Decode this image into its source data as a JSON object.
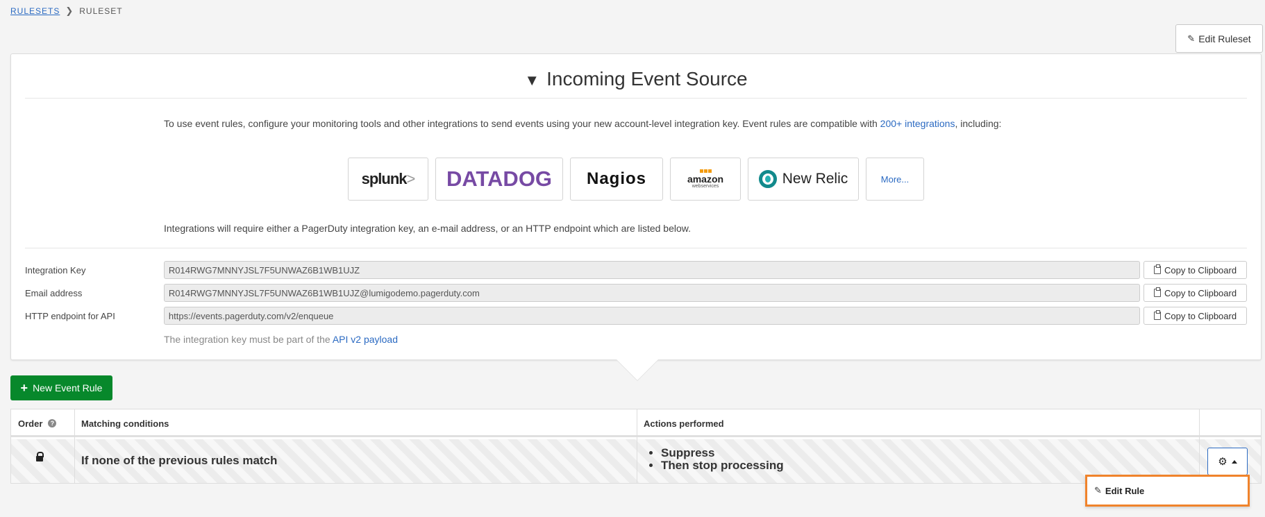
{
  "breadcrumb": {
    "link": "RULESETS",
    "separator": "❯",
    "current": "RULESET"
  },
  "header": {
    "edit_ruleset_label": "Edit Ruleset"
  },
  "panel": {
    "title": "Incoming Event Source",
    "toggle_glyph": "▼",
    "intro_prefix": "To use event rules, configure your monitoring tools and other integrations to send events using your new account-level integration key. Event rules are compatible with ",
    "intro_link": "200+ integrations",
    "intro_suffix": ", including:",
    "logos": {
      "splunk": "splunk",
      "splunk_mark": ">",
      "datadog": "DATADOG",
      "nagios": "Nagios",
      "amazon": "amazon",
      "amazon_sub": "webservices",
      "newrelic": "New Relic",
      "more": "More..."
    },
    "requirement_text": "Integrations will require either a PagerDuty integration key, an e-mail address, or an HTTP endpoint which are listed below.",
    "fields": [
      {
        "label": "Integration Key",
        "value": "R014RWG7MNNYJSL7F5UNWAZ6B1WB1UJZ",
        "button": "Copy to Clipboard"
      },
      {
        "label": "Email address",
        "value": "R014RWG7MNNYJSL7F5UNWAZ6B1WB1UJZ@lumigodemo.pagerduty.com",
        "button": "Copy to Clipboard"
      },
      {
        "label": "HTTP endpoint for API",
        "value": "https://events.pagerduty.com/v2/enqueue",
        "button": "Copy to Clipboard"
      }
    ],
    "help_prefix": "The integration key must be part of the ",
    "help_link": "API v2 payload"
  },
  "new_rule_button": {
    "icon": "+",
    "label": "New Event Rule"
  },
  "table": {
    "headers": {
      "order": "Order",
      "help_glyph": "?",
      "conditions": "Matching conditions",
      "actions": "Actions performed"
    },
    "rows": [
      {
        "condition": "If none of the previous rules match",
        "actions": [
          "Suppress",
          "Then stop processing"
        ]
      }
    ]
  },
  "row_menu": {
    "gear_glyph": "⚙",
    "edit_icon": "✎",
    "edit_label": "Edit Rule"
  },
  "colors": {
    "accent": "#2b6ac2",
    "primary_button": "#07882b",
    "highlight": "#f0832b",
    "datadog": "#774aa4"
  }
}
